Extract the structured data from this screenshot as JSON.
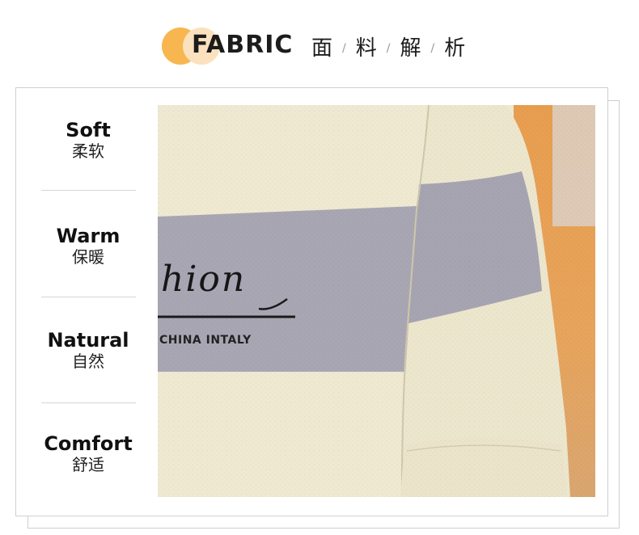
{
  "header": {
    "title_en": "FABRIC",
    "title_cn": [
      "面",
      "料",
      "解",
      "析"
    ],
    "separator": "/"
  },
  "features": [
    {
      "en": "Soft",
      "cn": "柔软"
    },
    {
      "en": "Warm",
      "cn": "保暖"
    },
    {
      "en": "Natural",
      "cn": "自然"
    },
    {
      "en": "Comfort",
      "cn": "舒适"
    }
  ],
  "photo": {
    "print_script": "hion",
    "print_text": "CHINA INTALY"
  },
  "colors": {
    "accent_orange": "#f7b650",
    "accent_light": "#fbe1bd",
    "stripe_gray": "#a9a6b4",
    "knit_cream": "#efe9d2"
  }
}
